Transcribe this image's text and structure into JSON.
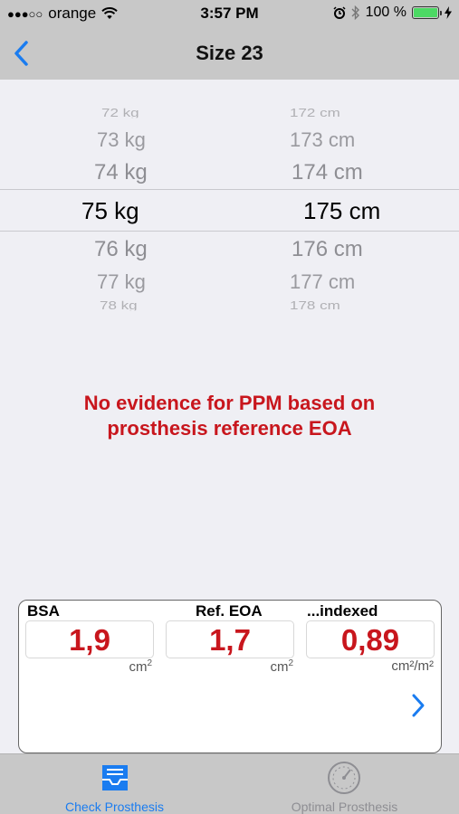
{
  "status_bar": {
    "signal": "●●●○○",
    "carrier": "orange",
    "time": "3:57 PM",
    "battery_text": "100 %"
  },
  "nav": {
    "title": "Size 23",
    "back_icon": "chevron-left-icon"
  },
  "picker": {
    "weight": [
      "72 kg",
      "73 kg",
      "74 kg",
      "75 kg",
      "76 kg",
      "77 kg",
      "78 kg"
    ],
    "height": [
      "172 cm",
      "173 cm",
      "174 cm",
      "175 cm",
      "176 cm",
      "177 cm",
      "178 cm"
    ],
    "selected_weight": "75 kg",
    "selected_height": "175 cm"
  },
  "message": {
    "line1": "No evidence for PPM based on",
    "line2": "prosthesis reference EOA"
  },
  "results": {
    "bsa": {
      "label": "BSA",
      "value": "1,9",
      "unit": "cm",
      "unit_sup": "2"
    },
    "ref_eoa": {
      "label": "Ref. EOA",
      "value": "1,7",
      "unit": "cm",
      "unit_sup": "2"
    },
    "indexed": {
      "label": "...indexed",
      "value": "0,89",
      "unit": "cm²/m²"
    }
  },
  "tabs": [
    {
      "label": "Check Prosthesis",
      "icon": "inbox-tray-icon",
      "active": true
    },
    {
      "label": "Optimal Prosthesis",
      "icon": "gauge-icon",
      "active": false
    }
  ],
  "colors": {
    "accent": "#1a7cf0",
    "alert": "#c8161d",
    "bar": "#c8c8c8",
    "background": "#efeff4"
  }
}
